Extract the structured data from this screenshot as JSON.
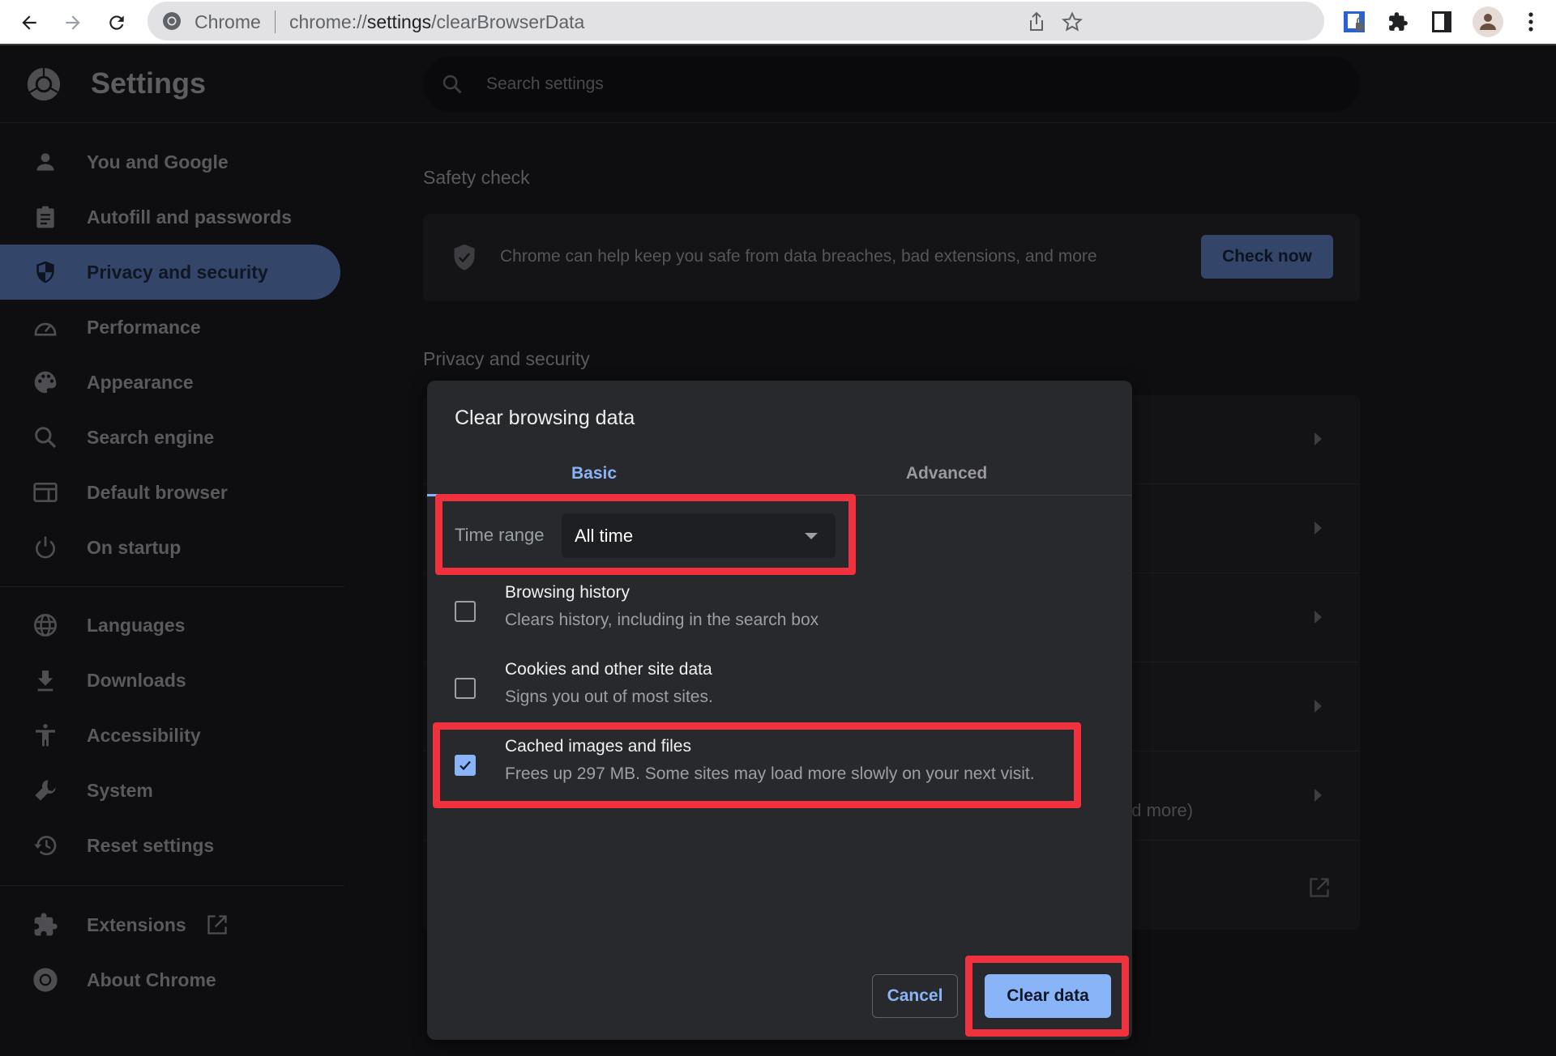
{
  "browser": {
    "site_label": "Chrome",
    "url_prefix": "chrome://",
    "url_host": "settings",
    "url_path": "/clearBrowserData"
  },
  "header": {
    "title": "Settings",
    "search_placeholder": "Search settings"
  },
  "sidebar": {
    "items": [
      {
        "label": "You and Google",
        "icon": "person-icon"
      },
      {
        "label": "Autofill and passwords",
        "icon": "clipboard-icon"
      },
      {
        "label": "Privacy and security",
        "icon": "shield-icon",
        "active": true
      },
      {
        "label": "Performance",
        "icon": "speedometer-icon"
      },
      {
        "label": "Appearance",
        "icon": "palette-icon"
      },
      {
        "label": "Search engine",
        "icon": "search-icon"
      },
      {
        "label": "Default browser",
        "icon": "browser-window-icon"
      },
      {
        "label": "On startup",
        "icon": "power-icon"
      },
      {
        "label": "Languages",
        "icon": "globe-icon"
      },
      {
        "label": "Downloads",
        "icon": "download-icon"
      },
      {
        "label": "Accessibility",
        "icon": "accessibility-icon"
      },
      {
        "label": "System",
        "icon": "wrench-icon"
      },
      {
        "label": "Reset settings",
        "icon": "restore-icon"
      },
      {
        "label": "Extensions",
        "icon": "puzzle-icon"
      },
      {
        "label": "About Chrome",
        "icon": "chrome-icon"
      }
    ]
  },
  "main": {
    "safety_check": {
      "title": "Safety check",
      "text": "Chrome can help keep you safe from data breaches, bad extensions, and more",
      "button": "Check now"
    },
    "privacy_section": {
      "title": "Privacy and security",
      "partial_text": "nd more)"
    }
  },
  "dialog": {
    "title": "Clear browsing data",
    "tabs": [
      {
        "label": "Basic",
        "active": true
      },
      {
        "label": "Advanced",
        "active": false
      }
    ],
    "time_range": {
      "label": "Time range",
      "value": "All time"
    },
    "options": [
      {
        "title": "Browsing history",
        "description": "Clears history, including in the search box",
        "checked": false
      },
      {
        "title": "Cookies and other site data",
        "description": "Signs you out of most sites.",
        "checked": false
      },
      {
        "title": "Cached images and files",
        "description": "Frees up 297 MB. Some sites may load more slowly on your next visit.",
        "checked": true
      }
    ],
    "cancel_label": "Cancel",
    "confirm_label": "Clear data"
  },
  "colors": {
    "accent": "#8ab4f8",
    "annotation_highlight": "#f0323e",
    "active_nav": "#33466a"
  }
}
